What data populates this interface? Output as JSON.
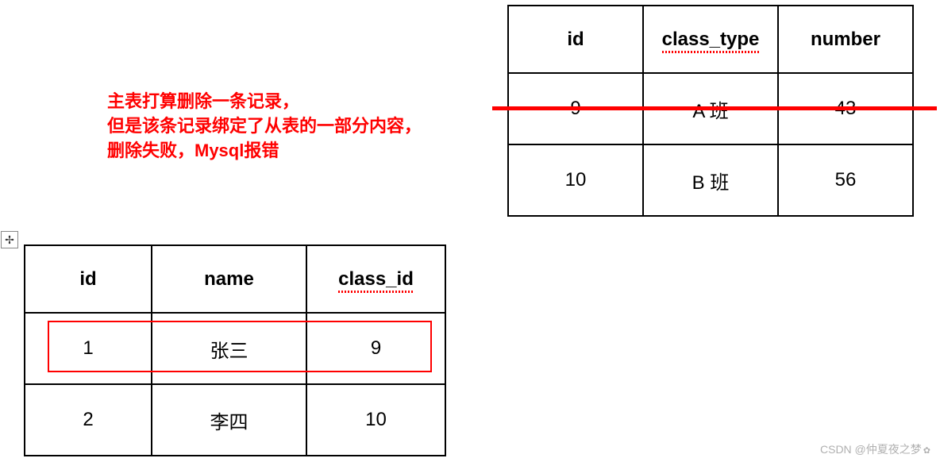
{
  "annotation": {
    "line1": "主表打算删除一条记录，",
    "line2": "但是该条记录绑定了从表的一部分内容，",
    "line3": "删除失败，Mysql报错"
  },
  "master_table": {
    "headers": [
      "id",
      "class_type",
      "number"
    ],
    "rows": [
      {
        "id": "9",
        "class_type": "A 班",
        "number": "43"
      },
      {
        "id": "10",
        "class_type": "B 班",
        "number": "56"
      }
    ]
  },
  "slave_table": {
    "headers": [
      "id",
      "name",
      "class_id"
    ],
    "rows": [
      {
        "id": "1",
        "name": "张三",
        "class_id": "9"
      },
      {
        "id": "2",
        "name": "李四",
        "class_id": "10"
      }
    ]
  },
  "move_glyph": "✢",
  "watermark": "CSDN @仲夏夜之梦"
}
